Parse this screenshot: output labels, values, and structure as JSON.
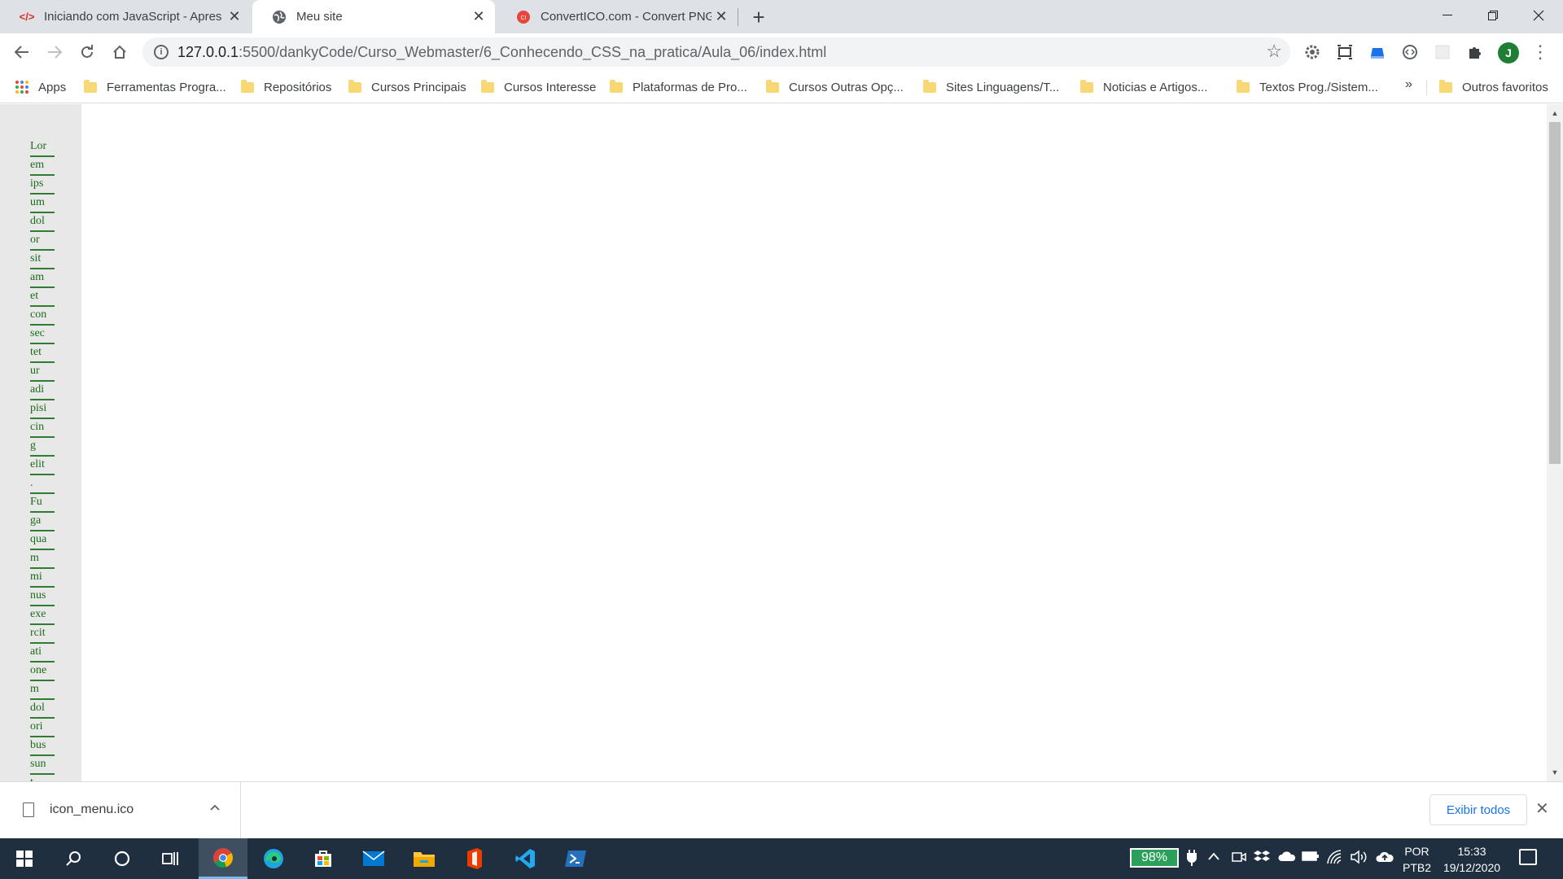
{
  "browser": {
    "tabs": [
      {
        "title": "Iniciando com JavaScript - Apres",
        "favicon": "code-icon",
        "active": false
      },
      {
        "title": "Meu site",
        "favicon": "globe-icon",
        "active": true
      },
      {
        "title": "ConvertICO.com - Convert PNG t",
        "favicon": "converter-icon",
        "active": false
      }
    ],
    "new_tab": "+",
    "window_controls": {
      "minimize": "—",
      "maximize": "❐",
      "close": "✕"
    }
  },
  "toolbar": {
    "url_host": "127.0.0.1",
    "url_path": ":5500/dankyCode/Curso_Webmaster/6_Conhecendo_CSS_na_pratica/Aula_06/index.html",
    "profile_initial": "J"
  },
  "bookmarks": {
    "apps_label": "Apps",
    "items": [
      "Ferramentas Progra...",
      "Repositórios",
      "Cursos Principais",
      "Cursos Interesse",
      "Plataformas de Pro...",
      "Cursos Outras Opç...",
      "Sites Linguagens/T...",
      "Noticias e Artigos...",
      "Textos Prog./Sistem..."
    ],
    "overflow": "»",
    "other_favorites": "Outros favoritos"
  },
  "page": {
    "words": [
      "Lor",
      "em",
      "ips",
      "um",
      "dol",
      "or",
      "sit",
      "am",
      "et",
      "con",
      "sec",
      "tet",
      "ur",
      "adi",
      "pisi",
      "cin",
      "g",
      "elit",
      ".",
      "Fu",
      "ga",
      "qua",
      "m",
      "mi",
      "nus",
      "exe",
      "rcit",
      "ati",
      "one",
      "m",
      "dol",
      "ori",
      "bus",
      "sun",
      "t"
    ]
  },
  "downloads": {
    "filename": "icon_menu.ico",
    "show_all_label": "Exibir todos"
  },
  "taskbar": {
    "battery": "98%",
    "language_top": "POR",
    "language_bottom": "PTB2",
    "time": "15:33",
    "date": "19/12/2020"
  },
  "colors": {
    "link_green": "#1a6c1a",
    "taskbar_bg": "#1f2f3f",
    "battery_green": "#2aa05a"
  }
}
